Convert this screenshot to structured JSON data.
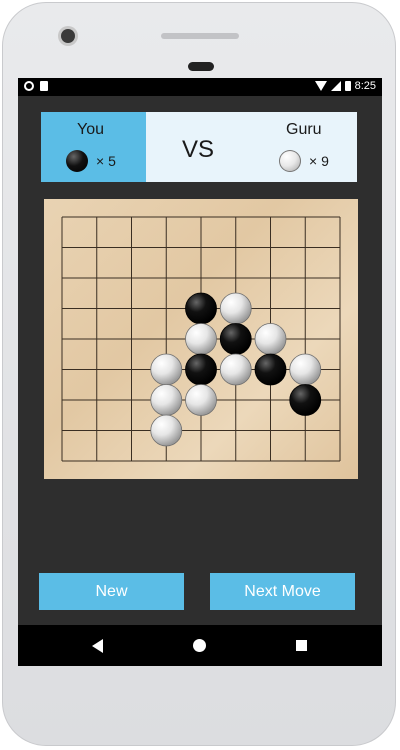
{
  "status_bar": {
    "time": "8:25"
  },
  "players": {
    "you": {
      "name": "You",
      "count_text": "× 5",
      "stone": "black"
    },
    "vs": "VS",
    "guru": {
      "name": "Guru",
      "count_text": "× 9",
      "stone": "white"
    }
  },
  "board": {
    "size": 9,
    "stones": [
      {
        "row": 3,
        "col": 4,
        "color": "black"
      },
      {
        "row": 3,
        "col": 5,
        "color": "white"
      },
      {
        "row": 4,
        "col": 4,
        "color": "white"
      },
      {
        "row": 4,
        "col": 5,
        "color": "black"
      },
      {
        "row": 4,
        "col": 6,
        "color": "white"
      },
      {
        "row": 5,
        "col": 3,
        "color": "white"
      },
      {
        "row": 5,
        "col": 4,
        "color": "black"
      },
      {
        "row": 5,
        "col": 5,
        "color": "white"
      },
      {
        "row": 5,
        "col": 6,
        "color": "black"
      },
      {
        "row": 5,
        "col": 7,
        "color": "white"
      },
      {
        "row": 6,
        "col": 3,
        "color": "white"
      },
      {
        "row": 6,
        "col": 4,
        "color": "white"
      },
      {
        "row": 6,
        "col": 7,
        "color": "black"
      },
      {
        "row": 7,
        "col": 3,
        "color": "white"
      }
    ]
  },
  "buttons": {
    "new": "New",
    "next_move": "Next Move"
  },
  "colors": {
    "accent": "#5bbde6",
    "screen_bg": "#2e2e2e",
    "panel_bg": "#e8f4fb"
  }
}
